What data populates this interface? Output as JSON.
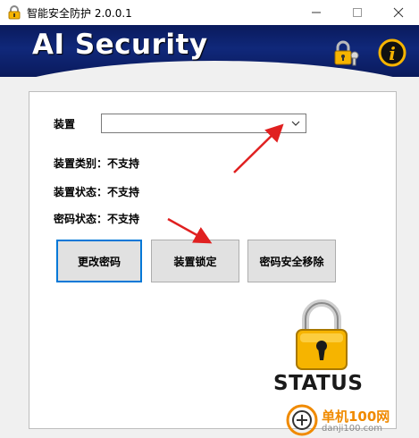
{
  "window": {
    "title": "智能安全防护 2.0.0.1",
    "minimize_icon": "minimize-icon",
    "maximize_icon": "maximize-icon",
    "close_icon": "close-icon"
  },
  "header": {
    "title": "AI Security",
    "lock_key_icon": "lock-key-icon",
    "info_icon": "info-icon"
  },
  "device": {
    "label": "装置",
    "selected": ""
  },
  "info": {
    "category": "装置类别：不支持",
    "device_status": "装置状态：不支持",
    "password_status": "密码状态：不支持"
  },
  "buttons": {
    "change_password": "更改密码",
    "lock_device": "装置锁定",
    "remove_password": "密码安全移除"
  },
  "status": {
    "label": "STATUS",
    "icon": "padlock-icon"
  },
  "watermark": {
    "name": "单机100网",
    "url": "danji100.com"
  },
  "colors": {
    "header_bg": "#10287a",
    "focus_border": "#0078d7",
    "annotation_arrow": "#e02020",
    "padlock_gold": "#f6b400"
  }
}
